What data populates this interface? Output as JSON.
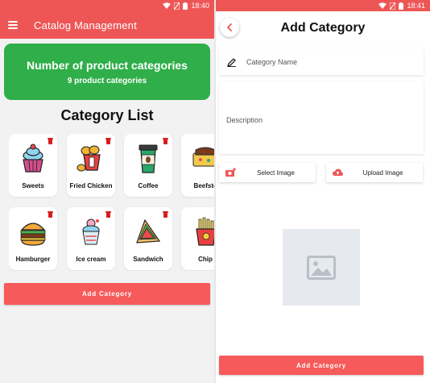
{
  "left_screen": {
    "status_time": "18:40",
    "appbar_title": "Catalog Management",
    "stats": {
      "title": "Number of product categories",
      "subtitle": "9 product categories"
    },
    "section_title": "Category List",
    "categories": [
      {
        "label": "Sweets",
        "icon": "cupcake-icon"
      },
      {
        "label": "Fried Chicken",
        "icon": "fried-chicken-icon"
      },
      {
        "label": "Coffee",
        "icon": "coffee-cup-icon"
      },
      {
        "label": "Beefste",
        "icon": "steak-icon"
      },
      {
        "label": "Hamburger",
        "icon": "hamburger-icon"
      },
      {
        "label": "Ice cream",
        "icon": "ice-cream-icon"
      },
      {
        "label": "Sandwich",
        "icon": "sandwich-icon"
      },
      {
        "label": "Chip",
        "icon": "fries-icon"
      }
    ],
    "add_button": "Add Category"
  },
  "right_screen": {
    "status_time": "18:41",
    "page_title": "Add Category",
    "name_placeholder": "Category Name",
    "description_placeholder": "Description",
    "select_image": "Select Image",
    "upload_image": "Upload Image",
    "add_button": "Add Category"
  },
  "colors": {
    "primary": "#ee5656",
    "button": "#f65a5a",
    "stats_card": "#2fae49",
    "delete": "#d81d1d",
    "background": "#f2f2f2"
  }
}
